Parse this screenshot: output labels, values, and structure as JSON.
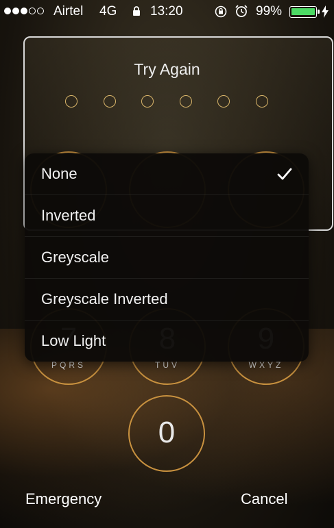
{
  "status_bar": {
    "carrier": "Airtel",
    "network": "4G",
    "time": "13:20",
    "battery_percent": "99%",
    "signal_bars_filled": 3,
    "signal_bars_total": 5,
    "battery_level": 0.99,
    "battery_color": "#4cd964"
  },
  "passcode": {
    "prompt": "Try Again",
    "digits_total": 6
  },
  "keypad": {
    "keys": [
      {
        "number": "7",
        "letters": "PQRS"
      },
      {
        "number": "8",
        "letters": "TUV"
      },
      {
        "number": "9",
        "letters": "WXYZ"
      },
      {
        "number": "0",
        "letters": ""
      }
    ],
    "ring_color": "#c8913f"
  },
  "filter_menu": {
    "items": [
      {
        "label": "None",
        "selected": true
      },
      {
        "label": "Inverted",
        "selected": false
      },
      {
        "label": "Greyscale",
        "selected": false
      },
      {
        "label": "Greyscale Inverted",
        "selected": false
      },
      {
        "label": "Low Light",
        "selected": false
      }
    ]
  },
  "actions": {
    "emergency": "Emergency",
    "cancel": "Cancel"
  }
}
